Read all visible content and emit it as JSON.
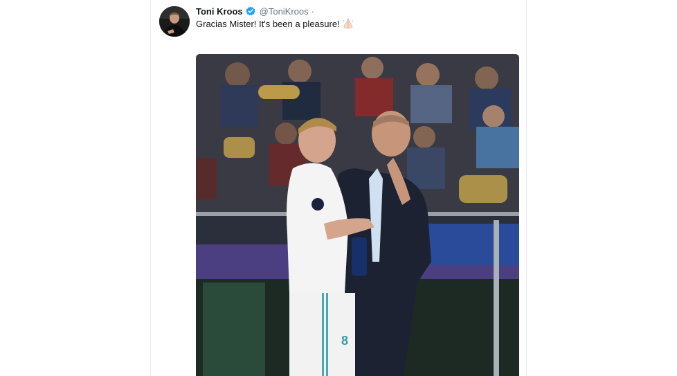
{
  "tweet": {
    "display_name": "Toni Kroos",
    "handle": "@ToniKroos",
    "separator": "·",
    "text": "Gracias Mister! It's been a pleasure!",
    "verified_icon": "verified-badge-icon",
    "emoji_icon": "folded-hands-emoji-icon"
  },
  "colors": {
    "verified": "#1da1f2",
    "name": "#14171a",
    "muted": "#657786"
  }
}
